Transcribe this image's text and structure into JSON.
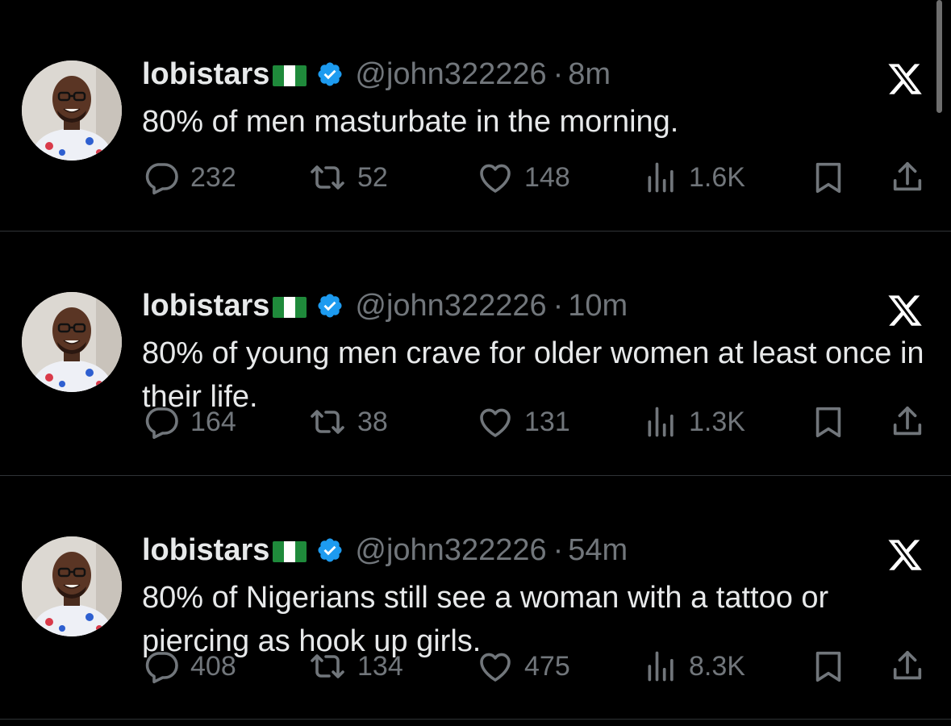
{
  "colors": {
    "background": "#000000",
    "text_primary": "#e7e9ea",
    "text_secondary": "#71767b",
    "verified_badge": "#1d9bf0",
    "divider": "#2f3336"
  },
  "tweets": [
    {
      "display_name": "lobistars",
      "flag_icon": "nigeria-flag-icon",
      "verified_icon": "verified-badge-icon",
      "handle": "@john322226",
      "separator": "·",
      "time": "8m",
      "text": "80% of men masturbate in the morning.",
      "replies": "232",
      "retweets": "52",
      "likes": "148",
      "views": "1.6K"
    },
    {
      "display_name": "lobistars",
      "flag_icon": "nigeria-flag-icon",
      "verified_icon": "verified-badge-icon",
      "handle": "@john322226",
      "separator": "·",
      "time": "10m",
      "text": "80% of young men crave for older women at least once in their life.",
      "replies": "164",
      "retweets": "38",
      "likes": "131",
      "views": "1.3K"
    },
    {
      "display_name": "lobistars",
      "flag_icon": "nigeria-flag-icon",
      "verified_icon": "verified-badge-icon",
      "handle": "@john322226",
      "separator": "·",
      "time": "54m",
      "text": "80% of Nigerians still see a woman with a tattoo or piercing as hook up girls.",
      "replies": "408",
      "retweets": "134",
      "likes": "475",
      "views": "8.3K"
    }
  ]
}
